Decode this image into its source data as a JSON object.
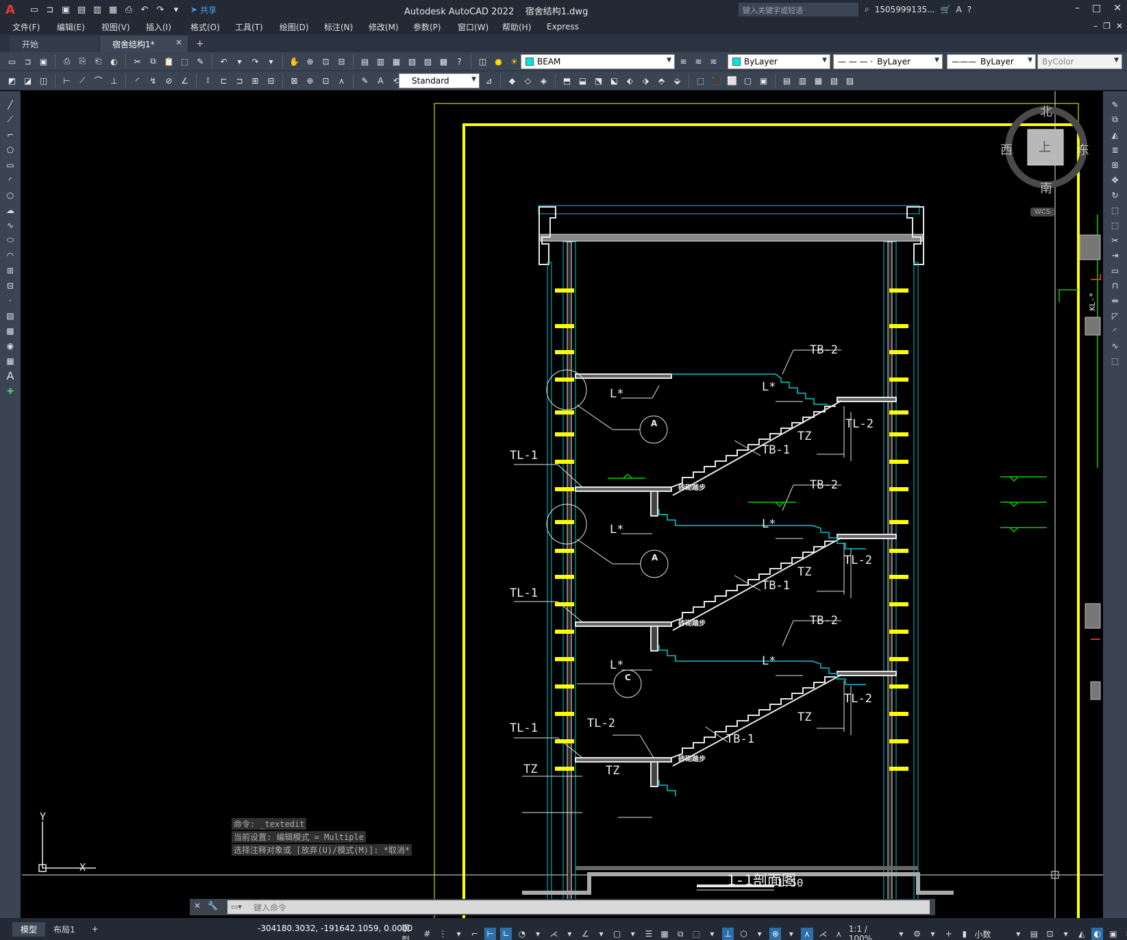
{
  "titlebar": {
    "logo": "A",
    "share_label": "共享",
    "app_title": "Autodesk AutoCAD 2022",
    "file_title": "宿舍结构1.dwg",
    "search_placeholder": "键入关键字或短语",
    "user": "1505999135..."
  },
  "menubar": {
    "items": [
      "文件(F)",
      "编辑(E)",
      "视图(V)",
      "插入(I)",
      "格式(O)",
      "工具(T)",
      "绘图(D)",
      "标注(N)",
      "修改(M)",
      "参数(P)",
      "窗口(W)",
      "帮助(H)",
      "Express"
    ]
  },
  "tabs": {
    "start": "开始",
    "doc": "宿舍结构1*",
    "add": "+"
  },
  "toolbar1": {
    "layer": "BEAM",
    "layer_color": "#00e5e5",
    "color": "ByLayer",
    "linetype": "ByLayer",
    "lineweight": "ByLayer",
    "plotstyle": "ByColor"
  },
  "toolbar2": {
    "textstyle": "Standard"
  },
  "viewcube": {
    "north": "北",
    "south": "南",
    "east": "东",
    "west": "西",
    "top": "上",
    "wcs": "WCS"
  },
  "drawing": {
    "labels": {
      "tb2": "TB-2",
      "tb1": "TB-1",
      "tl1": "TL-1",
      "tl2": "TL-2",
      "tz": "TZ",
      "l": "L*",
      "step": "砖砌踏步",
      "a": "A",
      "c": "C"
    },
    "section_title": "1-1剖面图",
    "scale": "1:50",
    "ucs_x": "X",
    "ucs_y": "Y",
    "kl": "KL-*"
  },
  "command": {
    "history": [
      "命令: _textedit",
      "当前设置: 编辑模式 = Multiple",
      "选择注释对象或 [放弃(U)/模式(M)]: *取消*"
    ],
    "placeholder": "键入命令"
  },
  "statusbar": {
    "model_tab": "模型",
    "layout_tab": "布局1",
    "add": "+",
    "coords": "-304180.3032, -191642.1059, 0.0000",
    "space": "模型",
    "scale": "1:1 / 100%",
    "units": "小数"
  },
  "colors": {
    "yellow": "#ffff00",
    "cyan": "#00c8d0",
    "white": "#e8e8e8",
    "green": "#00d000",
    "red": "#ff2020"
  }
}
